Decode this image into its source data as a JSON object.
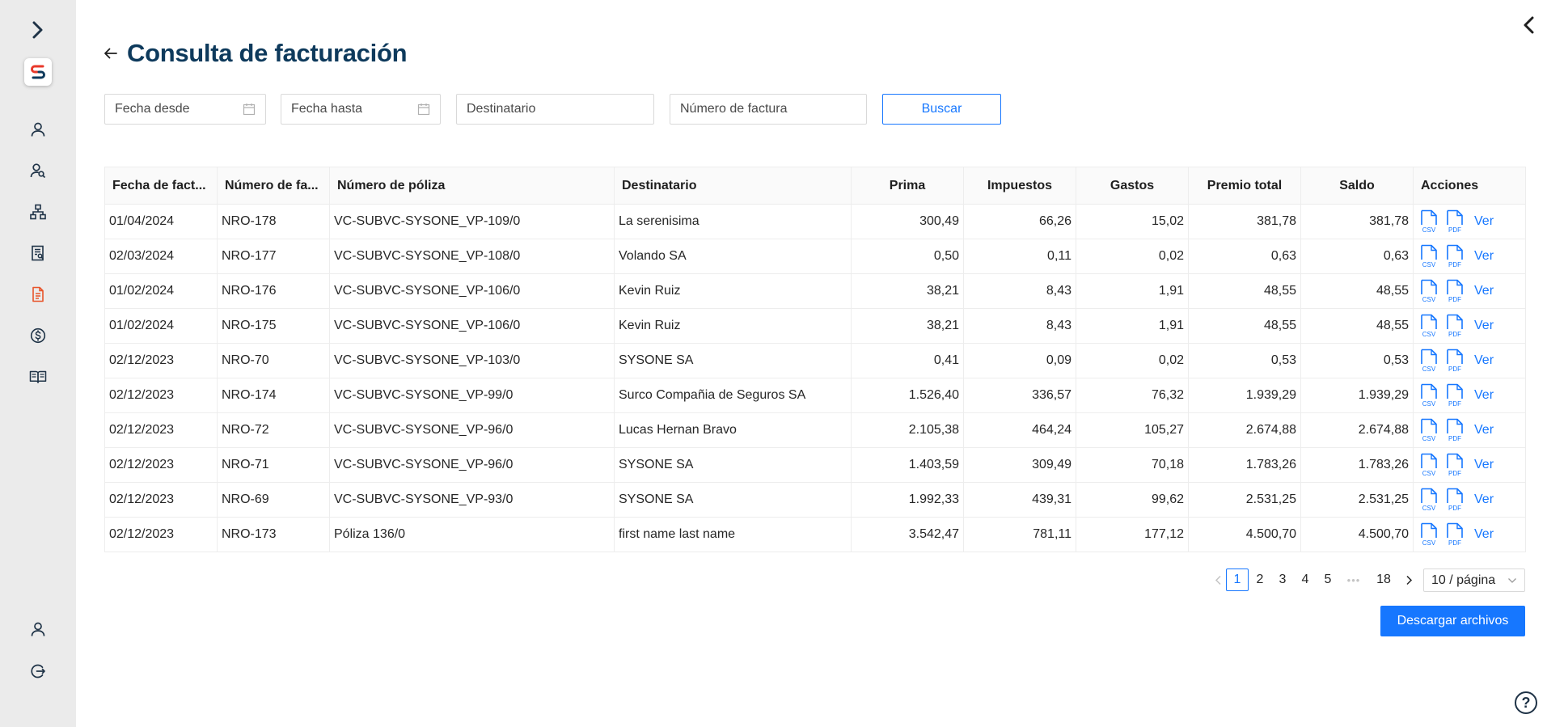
{
  "header": {
    "title": "Consulta de facturación"
  },
  "filters": {
    "fecha_desde": "Fecha desde",
    "fecha_hasta": "Fecha hasta",
    "destinatario": "Destinatario",
    "numero_factura": "Número de factura",
    "buscar_label": "Buscar"
  },
  "table": {
    "columns": [
      "Fecha de fact...",
      "Número de fa...",
      "Número de póliza",
      "Destinatario",
      "Prima",
      "Impuestos",
      "Gastos",
      "Premio total",
      "Saldo",
      "Acciones"
    ],
    "rows": [
      {
        "fecha": "01/04/2024",
        "numero": "NRO-178",
        "poliza": "VC-SUBVC-SYSONE_VP-109/0",
        "destinatario": "La serenisima",
        "prima": "300,49",
        "impuestos": "66,26",
        "gastos": "15,02",
        "premio": "381,78",
        "saldo": "381,78"
      },
      {
        "fecha": "02/03/2024",
        "numero": "NRO-177",
        "poliza": "VC-SUBVC-SYSONE_VP-108/0",
        "destinatario": "Volando SA",
        "prima": "0,50",
        "impuestos": "0,11",
        "gastos": "0,02",
        "premio": "0,63",
        "saldo": "0,63"
      },
      {
        "fecha": "01/02/2024",
        "numero": "NRO-176",
        "poliza": "VC-SUBVC-SYSONE_VP-106/0",
        "destinatario": "Kevin Ruiz",
        "prima": "38,21",
        "impuestos": "8,43",
        "gastos": "1,91",
        "premio": "48,55",
        "saldo": "48,55"
      },
      {
        "fecha": "01/02/2024",
        "numero": "NRO-175",
        "poliza": "VC-SUBVC-SYSONE_VP-106/0",
        "destinatario": "Kevin Ruiz",
        "prima": "38,21",
        "impuestos": "8,43",
        "gastos": "1,91",
        "premio": "48,55",
        "saldo": "48,55"
      },
      {
        "fecha": "02/12/2023",
        "numero": "NRO-70",
        "poliza": "VC-SUBVC-SYSONE_VP-103/0",
        "destinatario": "SYSONE SA",
        "prima": "0,41",
        "impuestos": "0,09",
        "gastos": "0,02",
        "premio": "0,53",
        "saldo": "0,53"
      },
      {
        "fecha": "02/12/2023",
        "numero": "NRO-174",
        "poliza": "VC-SUBVC-SYSONE_VP-99/0",
        "destinatario": "Surco Compañia de Seguros SA",
        "prima": "1.526,40",
        "impuestos": "336,57",
        "gastos": "76,32",
        "premio": "1.939,29",
        "saldo": "1.939,29"
      },
      {
        "fecha": "02/12/2023",
        "numero": "NRO-72",
        "poliza": "VC-SUBVC-SYSONE_VP-96/0",
        "destinatario": "Lucas Hernan Bravo",
        "prima": "2.105,38",
        "impuestos": "464,24",
        "gastos": "105,27",
        "premio": "2.674,88",
        "saldo": "2.674,88"
      },
      {
        "fecha": "02/12/2023",
        "numero": "NRO-71",
        "poliza": "VC-SUBVC-SYSONE_VP-96/0",
        "destinatario": "SYSONE SA",
        "prima": "1.403,59",
        "impuestos": "309,49",
        "gastos": "70,18",
        "premio": "1.783,26",
        "saldo": "1.783,26"
      },
      {
        "fecha": "02/12/2023",
        "numero": "NRO-69",
        "poliza": "VC-SUBVC-SYSONE_VP-93/0",
        "destinatario": "SYSONE SA",
        "prima": "1.992,33",
        "impuestos": "439,31",
        "gastos": "99,62",
        "premio": "2.531,25",
        "saldo": "2.531,25"
      },
      {
        "fecha": "02/12/2023",
        "numero": "NRO-173",
        "poliza": "Póliza 136/0",
        "destinatario": "first name last name",
        "prima": "3.542,47",
        "impuestos": "781,11",
        "gastos": "177,12",
        "premio": "4.500,70",
        "saldo": "4.500,70"
      }
    ],
    "csv_label": "CSV",
    "pdf_label": "PDF",
    "ver_label": "Ver"
  },
  "pagination": {
    "pages": [
      "1",
      "2",
      "3",
      "4",
      "5"
    ],
    "ellipsis": "•••",
    "last": "18",
    "current": "1",
    "page_size": "10 / página"
  },
  "actions": {
    "download_label": "Descargar archivos"
  },
  "help": {
    "label": "?"
  },
  "colors": {
    "primary": "#1677ff",
    "title": "#0e3a5c",
    "sidebar_bg": "#ebebeb",
    "icon_navy": "#1f3347",
    "active_icon": "#e8542a",
    "logo_red": "#e8382a",
    "logo_blue": "#0e3a5c"
  }
}
